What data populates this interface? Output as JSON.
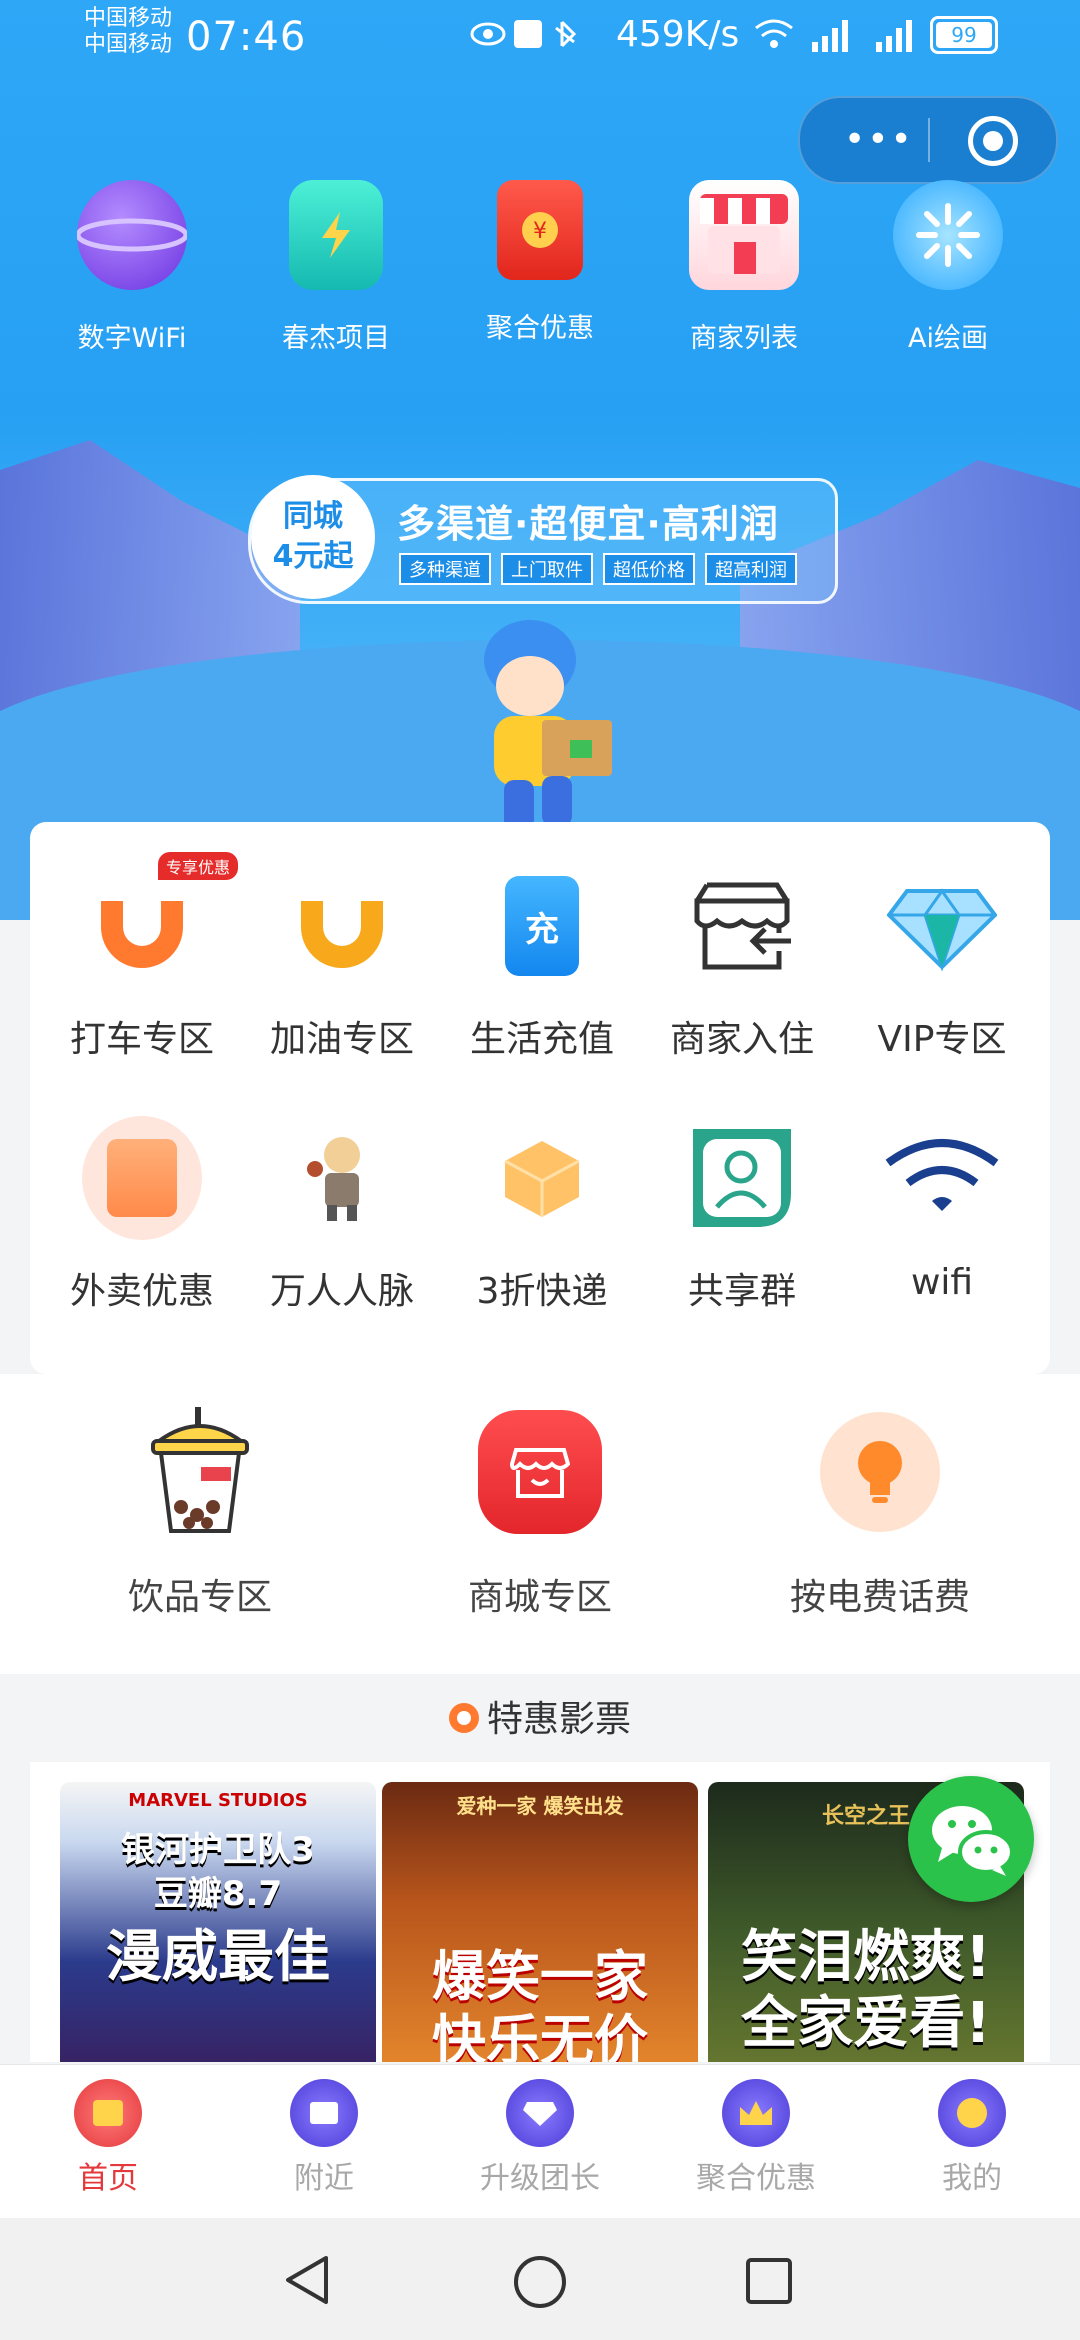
{
  "status_bar": {
    "carrier_1": "中国移动",
    "carrier_2": "中国移动",
    "time": "07:46",
    "net_speed": "459K/s",
    "battery": "99"
  },
  "capsule": {
    "more_icon": "more-dots-icon",
    "close_icon": "target-icon"
  },
  "top_menu": [
    {
      "label": "数字WiFi",
      "icon": "planet-icon"
    },
    {
      "label": "春杰项目",
      "icon": "phone-charge-icon"
    },
    {
      "label": "聚合优惠",
      "icon": "red-envelope-icon"
    },
    {
      "label": "商家列表",
      "icon": "store-icon"
    },
    {
      "label": "Ai绘画",
      "icon": "ai-burst-icon"
    }
  ],
  "banner": {
    "badge_line1": "同城",
    "badge_line2": "4元起",
    "slogan": "多渠道·超便宜·高利润",
    "tags": [
      "多种渠道",
      "上门取件",
      "超低价格",
      "超高利润"
    ]
  },
  "service_grid": [
    {
      "label": "打车专区",
      "icon": "didi-taxi-icon",
      "badge": "专享优惠"
    },
    {
      "label": "加油专区",
      "icon": "didi-fuel-icon"
    },
    {
      "label": "生活充值",
      "icon": "recharge-icon",
      "icon_text": "充"
    },
    {
      "label": "商家入住",
      "icon": "store-enter-icon"
    },
    {
      "label": "VIP专区",
      "icon": "diamond-icon"
    },
    {
      "label": "外卖优惠",
      "icon": "delivery-bag-icon"
    },
    {
      "label": "万人人脉",
      "icon": "character-icon"
    },
    {
      "label": "3折快递",
      "icon": "package-box-icon"
    },
    {
      "label": "共享群",
      "icon": "contact-card-icon"
    },
    {
      "label": "wifi",
      "icon": "wifi-icon"
    }
  ],
  "zones": [
    {
      "label": "饮品专区",
      "icon": "bubble-tea-icon"
    },
    {
      "label": "商城专区",
      "icon": "mall-store-icon"
    },
    {
      "label": "按电费话费",
      "icon": "lightbulb-icon"
    }
  ],
  "movies_section": {
    "title": "特惠影票",
    "posters": [
      {
        "line1": "银河护卫队3",
        "line2": "豆瓣8.7",
        "line3": "漫威最佳",
        "top": "MARVEL STUDIOS"
      },
      {
        "line1": "爆笑一家",
        "line2": "快乐无价",
        "top": "爱种一家 爆笑出发"
      },
      {
        "line1": "笑泪燃爽!",
        "line2": "全家爱看!",
        "top": "长空之王"
      }
    ]
  },
  "tabbar": [
    {
      "label": "首页",
      "active": true
    },
    {
      "label": "附近"
    },
    {
      "label": "升级团长"
    },
    {
      "label": "聚合优惠"
    },
    {
      "label": "我的"
    }
  ],
  "colors": {
    "primary_blue": "#27a0f3",
    "active_red": "#e4393c",
    "orange": "#ff7a2f",
    "wechat_green": "#2bc24c"
  }
}
